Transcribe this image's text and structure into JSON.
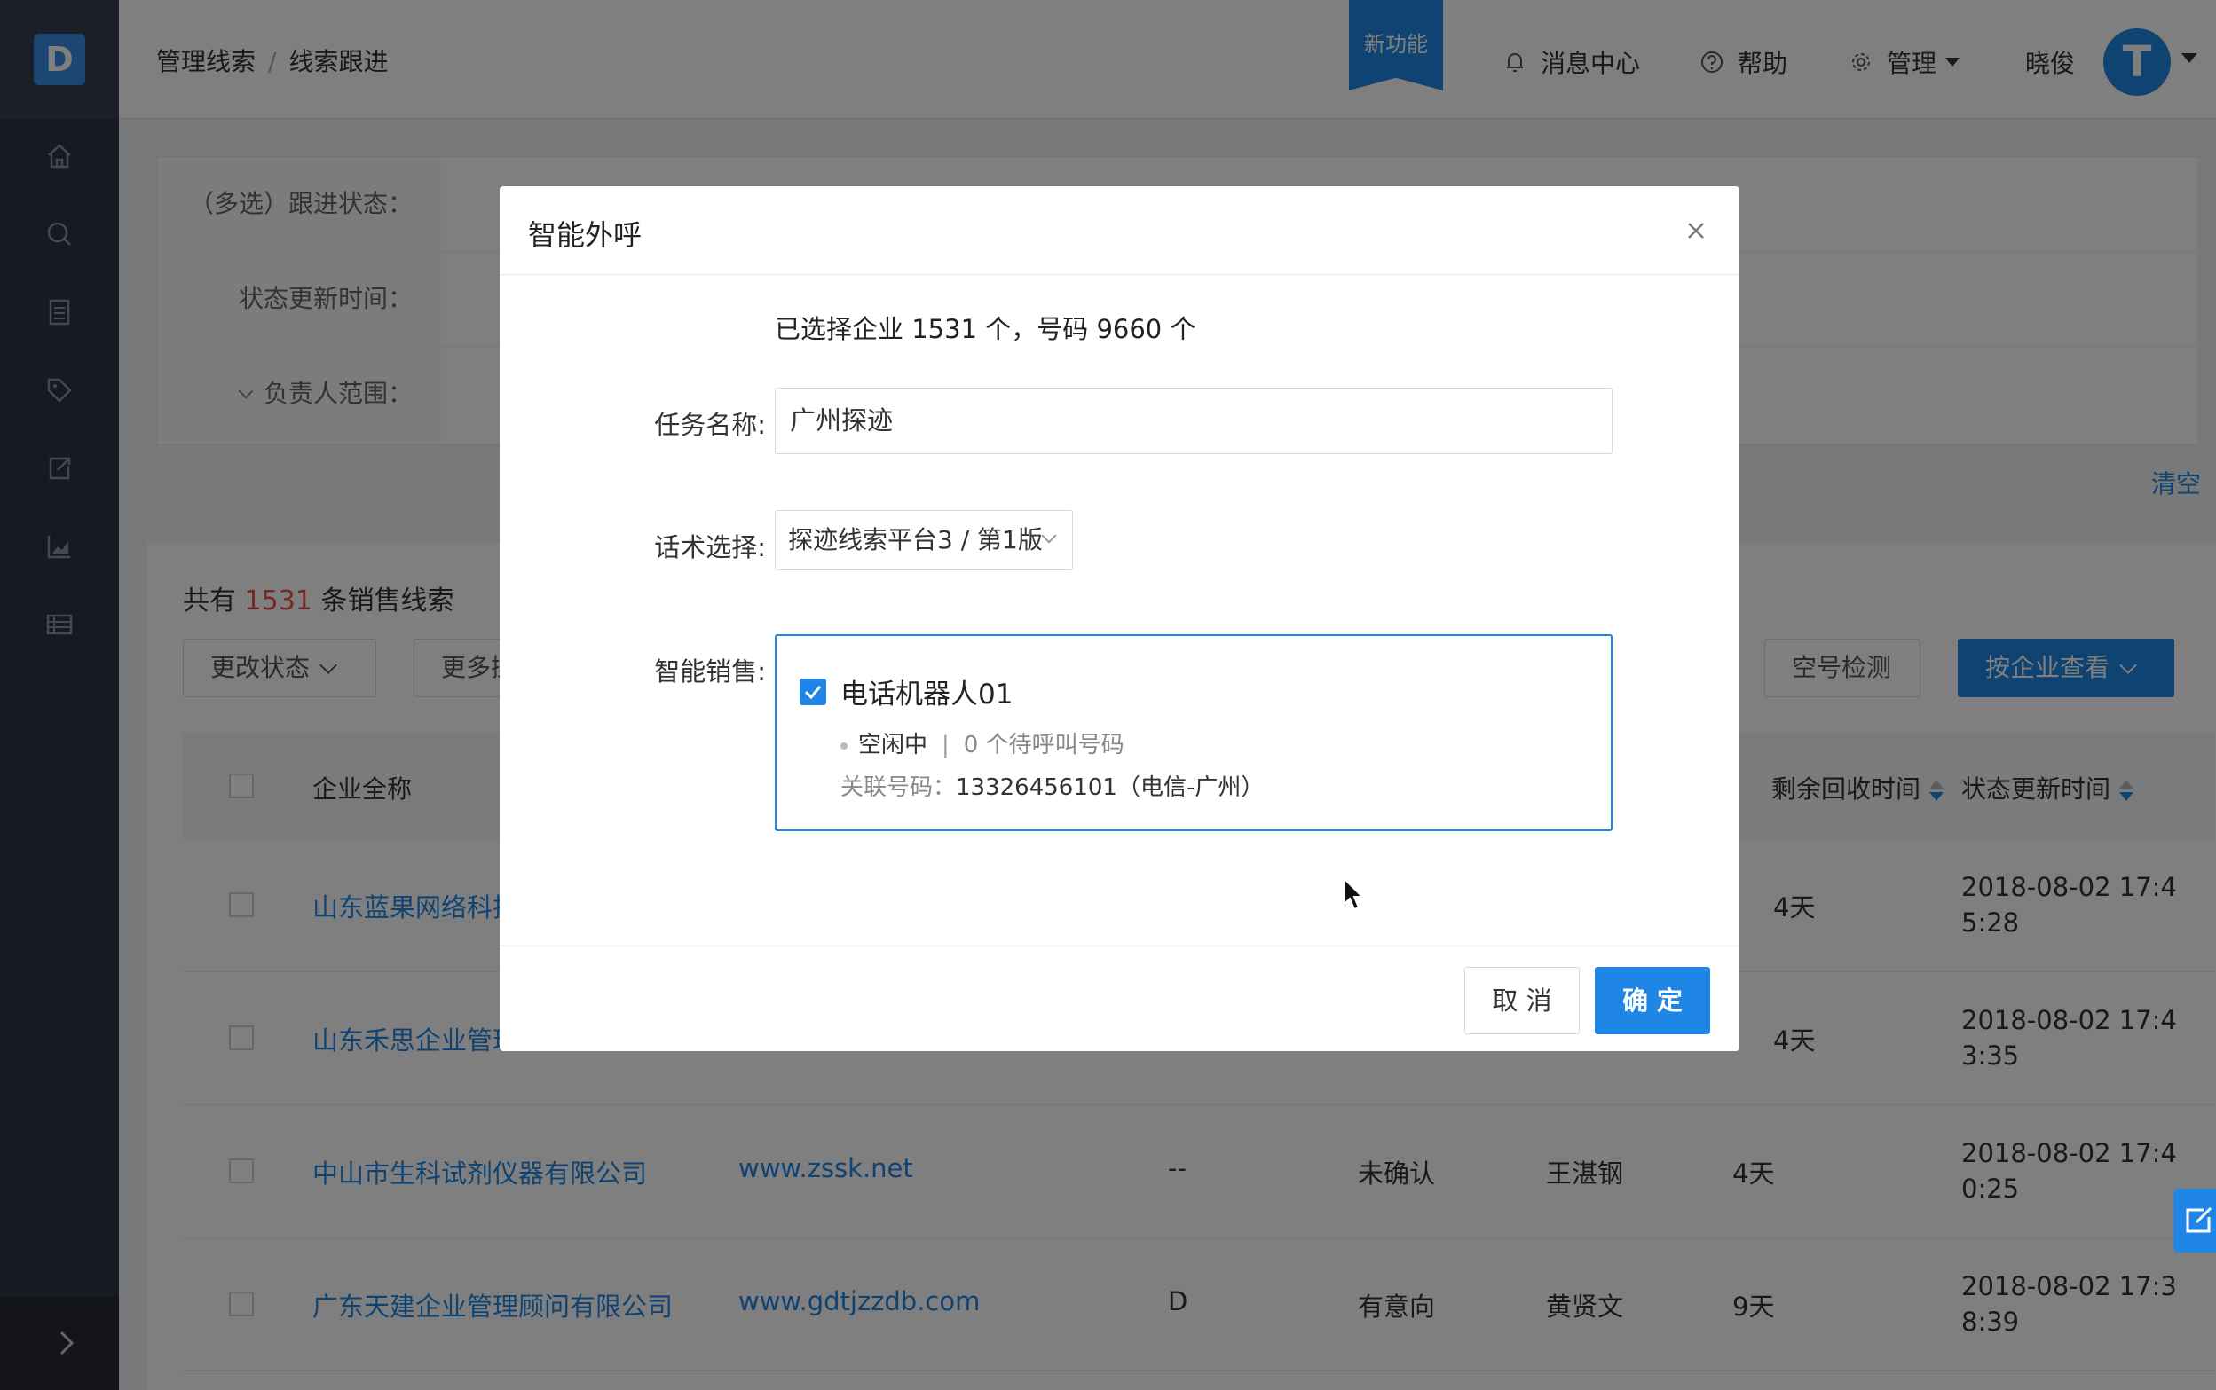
{
  "sidebar": {
    "logo_text": "D",
    "icons": [
      "home-icon",
      "search-icon",
      "document-icon",
      "tag-icon",
      "export-icon",
      "chart-icon",
      "list-icon"
    ]
  },
  "header": {
    "breadcrumb": [
      "管理线索",
      "线索跟进"
    ],
    "new_feature_badge": "新功能",
    "message_center": "消息中心",
    "help": "帮助",
    "manage": "管理",
    "user_name": "晓俊",
    "avatar_letter": "T"
  },
  "filters": {
    "follow_status_label": "（多选）跟进状态：",
    "update_time_label": "状态更新时间：",
    "owner_scope_label": "负责人范围：",
    "clear": "清空"
  },
  "list": {
    "title_prefix": "共有",
    "count": "1531",
    "title_suffix": "条销售线索",
    "change_status_button": "更改状态",
    "more_button": "更多操",
    "empty_check_button": "空号检测",
    "view_by_company_button": "按企业查看",
    "columns": {
      "company": "企业全称",
      "remaining": "剩余回收时间",
      "status_time": "状态更新时间"
    },
    "rows": [
      {
        "company": "山东蓝果网络科技",
        "website": "",
        "grade": "",
        "status": "",
        "owner": "",
        "remaining": "4天",
        "time_a": "2018-08-02 17:4",
        "time_b": "5:28"
      },
      {
        "company": "山东禾思企业管理",
        "website": "",
        "grade": "",
        "status": "",
        "owner": "",
        "remaining": "4天",
        "time_a": "2018-08-02 17:4",
        "time_b": "3:35"
      },
      {
        "company": "中山市生科试剂仪器有限公司",
        "website": "www.zssk.net",
        "grade": "--",
        "status": "未确认",
        "owner": "王湛钢",
        "remaining": "4天",
        "time_a": "2018-08-02 17:4",
        "time_b": "0:25"
      },
      {
        "company": "广东天建企业管理顾问有限公司",
        "website": "www.gdtjzzdb.com",
        "grade": "D",
        "status": "有意向",
        "owner": "黄贤文",
        "remaining": "9天",
        "time_a": "2018-08-02 17:3",
        "time_b": "8:39"
      }
    ]
  },
  "modal": {
    "title": "智能外呼",
    "summary": "已选择企业 1531 个，号码 9660 个",
    "task_name_label": "任务名称:",
    "task_name_value": "广州探迹",
    "script_label": "话术选择:",
    "script_value": "探迹线索平台3 / 第1版",
    "robot_label": "智能销售:",
    "robot_name": "电话机器人01",
    "robot_state": "空闲中",
    "robot_queue": "0 个待呼叫号码",
    "robot_phone_label": "关联号码：",
    "robot_phone_value": "13326456101（电信-广州）",
    "cancel": "取 消",
    "confirm": "确 定"
  },
  "colors": {
    "primary": "#1f86e5",
    "sidebar": "#2e3441",
    "highlight_number": "#e8524c"
  }
}
